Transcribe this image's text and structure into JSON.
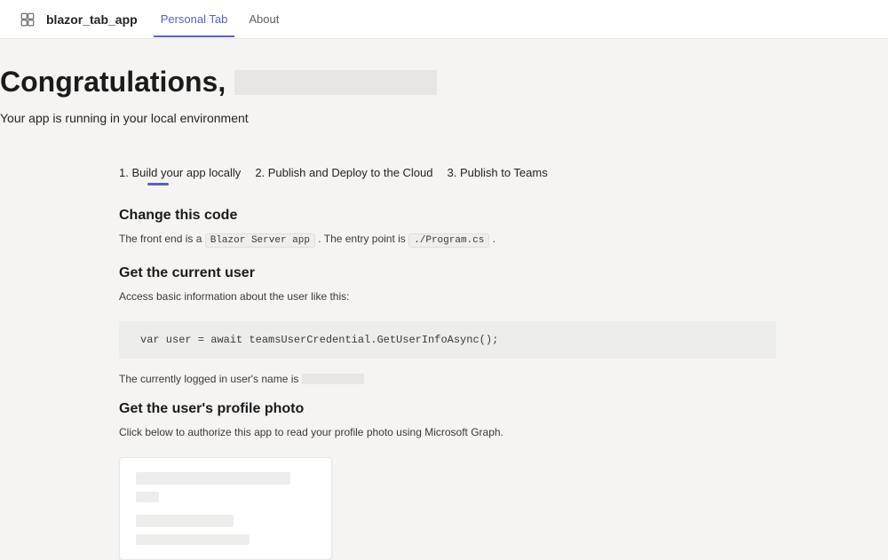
{
  "header": {
    "app_name": "blazor_tab_app",
    "tabs": {
      "personal": "Personal Tab",
      "about": "About"
    }
  },
  "hero": {
    "congrats": "Congratulations,",
    "subtext": "Your app is running in your local environment"
  },
  "steps": {
    "s1": "1. Build your app locally",
    "s2": "2. Publish and Deploy to the Cloud",
    "s3": "3. Publish to Teams"
  },
  "section1": {
    "heading": "Change this code",
    "prefix": "The front end is a ",
    "code1": "Blazor Server app",
    "mid": " . The entry point is ",
    "code2": "./Program.cs",
    "suffix": " ."
  },
  "section2": {
    "heading": "Get the current user",
    "text": "Access basic information about the user like this:",
    "code": "var user = await teamsUserCredential.GetUserInfoAsync();",
    "logged_in": "The currently logged in user's name is"
  },
  "section3": {
    "heading": "Get the user's profile photo",
    "text": "Click below to authorize this app to read your profile photo using Microsoft Graph."
  }
}
